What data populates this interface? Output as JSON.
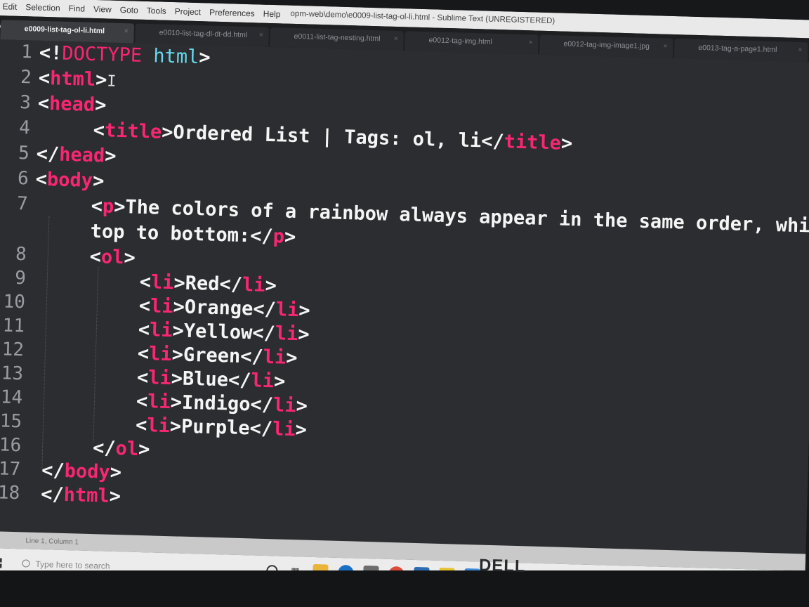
{
  "menubar": {
    "items": [
      "Edit",
      "Selection",
      "Find",
      "View",
      "Goto",
      "Tools",
      "Project",
      "Preferences",
      "Help"
    ],
    "window_title": "opm-web\\demo\\e0009-list-tag-ol-li.html - Sublime Text (UNREGISTERED)"
  },
  "tabs": [
    {
      "label": "e0009-list-tag-ol-li.html",
      "active": true
    },
    {
      "label": "e0010-list-tag-dl-dt-dd.html",
      "active": false
    },
    {
      "label": "e0011-list-tag-nesting.html",
      "active": false
    },
    {
      "label": "e0012-tag-img.html",
      "active": false
    },
    {
      "label": "e0012-tag-img-image1.jpg",
      "active": false
    },
    {
      "label": "e0013-tag-a-page1.html",
      "active": false
    }
  ],
  "line_numbers": [
    "1",
    "2",
    "3",
    "4",
    "5",
    "6",
    "7",
    "8",
    "9",
    "10",
    "11",
    "12",
    "13",
    "14",
    "15",
    "16",
    "17",
    "18"
  ],
  "code": {
    "doctype_open": "<!",
    "doctype_kw": "DOCTYPE",
    "doctype_attr": "html",
    "doctype_close": ">",
    "html_open": "html",
    "head_open": "head",
    "title_open": "title",
    "title_text": "Ordered List | Tags: ol, li",
    "head_close": "head",
    "body_open": "body",
    "p_open": "p",
    "p_text_1": "The colors of a rainbow always appear in the same order, which i",
    "p_text_2": "top to bottom:",
    "ol_open": "ol",
    "li_tag": "li",
    "items": [
      "Red",
      "Orange",
      "Yellow",
      "Green",
      "Blue",
      "Indigo",
      "Purple"
    ],
    "body_close": "body",
    "html_close": "html"
  },
  "statusbar": {
    "position": "Line 1, Column 1"
  },
  "taskbar": {
    "search_placeholder": "Type here to search",
    "icons": [
      "cortana-icon",
      "task-view-icon",
      "file-explorer-icon",
      "edge-icon",
      "store-icon",
      "chrome-icon",
      "mail-icon",
      "sticky-notes-icon",
      "app-icon"
    ]
  },
  "brand": {
    "logo": "DELL"
  },
  "colors": {
    "tag": "#f92672",
    "attr": "#66d9ef",
    "text": "#f5f5f5",
    "background": "#2b2d30"
  }
}
